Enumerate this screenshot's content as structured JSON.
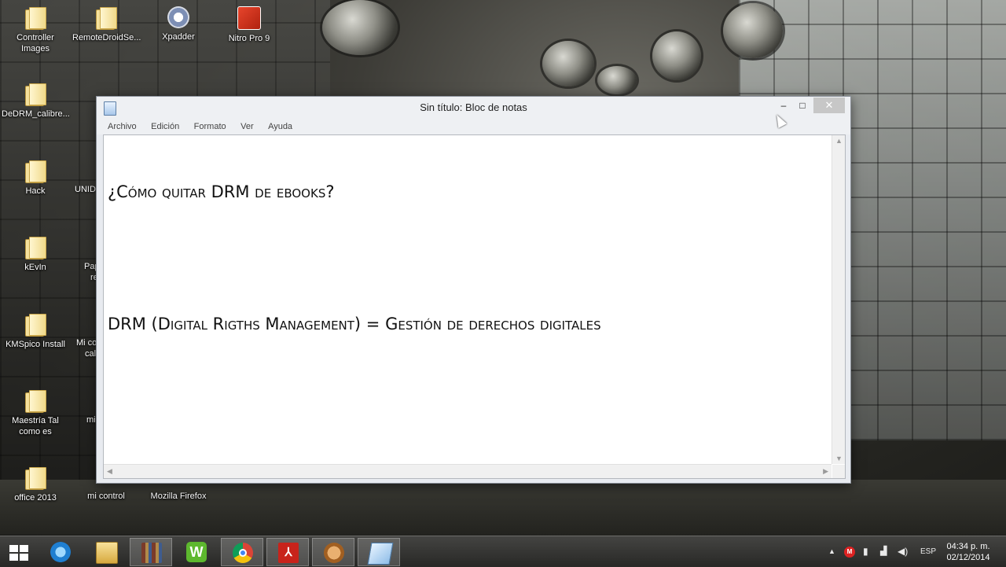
{
  "desktop": {
    "icons": [
      {
        "label": "Controller Images",
        "kind": "folder"
      },
      {
        "label": "RemoteDroidSe...",
        "kind": "folder"
      },
      {
        "label": "Xpadder",
        "kind": "app"
      },
      {
        "label": "Nitro Pro 9",
        "kind": "app"
      },
      {
        "label": "DeDRM_calibre...",
        "kind": "folder"
      },
      {
        "label": "Hack",
        "kind": "folder"
      },
      {
        "label": "kEvIn",
        "kind": "folder"
      },
      {
        "label": "KMSpico Install",
        "kind": "folder"
      },
      {
        "label": "Maestría Tal como es",
        "kind": "folder"
      },
      {
        "label": "office 2013",
        "kind": "folder"
      },
      {
        "label": "mi control",
        "kind": "app"
      },
      {
        "label": "Mozilla Firefox",
        "kind": "app"
      }
    ],
    "partial_labels": [
      "UNID",
      "Pap",
      "re",
      "Mi co",
      "cal",
      "mi"
    ]
  },
  "notepad": {
    "title": "Sin título: Bloc de notas",
    "menu": [
      "Archivo",
      "Edición",
      "Formato",
      "Ver",
      "Ayuda"
    ],
    "window_buttons": {
      "minimize": "–",
      "maximize": "□",
      "close": "✕"
    },
    "content_lines": [
      "¿Cómo quitar DRM de ebooks?",
      "",
      "DRM (Digital Rigths Management) = Gestión de derechos digitales"
    ]
  },
  "taskbar": {
    "pinned": [
      "start",
      "internet-explorer",
      "file-explorer",
      "books",
      "w-app",
      "chrome",
      "acrobat",
      "mitt-app",
      "notepad"
    ],
    "active": "books",
    "tray": {
      "language": "ESP",
      "time": "04:34 p. m.",
      "date": "02/12/2014",
      "icons": [
        "show-hidden-icons",
        "antivirus-icon",
        "battery-icon",
        "network-icon",
        "volume-icon"
      ]
    }
  },
  "colors": {
    "taskbar": "#2e2e2c",
    "close_button": "#c7c7c7",
    "pdf_red": "#c8231b"
  }
}
